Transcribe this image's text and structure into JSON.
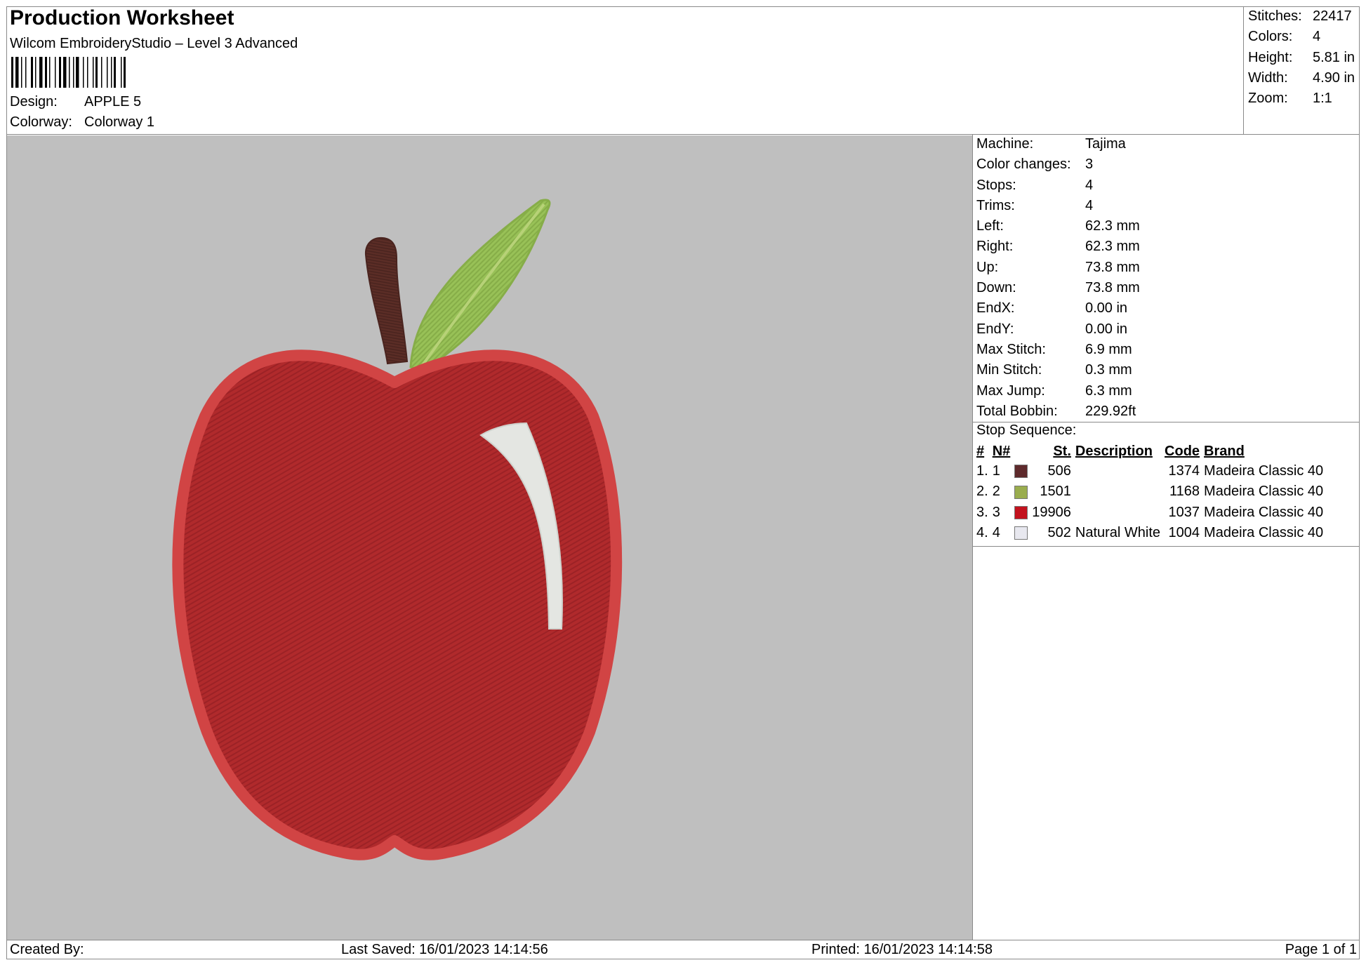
{
  "header": {
    "title": "Production Worksheet",
    "software": "Wilcom EmbroideryStudio – Level 3 Advanced",
    "design_label": "Design:",
    "design_value": "APPLE 5",
    "colorway_label": "Colorway:",
    "colorway_value": "Colorway 1"
  },
  "summary": [
    {
      "label": "Stitches:",
      "value": "22417"
    },
    {
      "label": "Colors:",
      "value": "4"
    },
    {
      "label": "Height:",
      "value": "5.81 in"
    },
    {
      "label": "Width:",
      "value": "4.90 in"
    },
    {
      "label": "Zoom:",
      "value": "1:1"
    }
  ],
  "specs": [
    {
      "label": "Machine:",
      "value": "Tajima"
    },
    {
      "label": "Color changes:",
      "value": "3"
    },
    {
      "label": "Stops:",
      "value": "4"
    },
    {
      "label": "Trims:",
      "value": "4"
    },
    {
      "label": "Left:",
      "value": "62.3 mm"
    },
    {
      "label": "Right:",
      "value": "62.3 mm"
    },
    {
      "label": "Up:",
      "value": "73.8 mm"
    },
    {
      "label": "Down:",
      "value": "73.8 mm"
    },
    {
      "label": "EndX:",
      "value": "0.00 in"
    },
    {
      "label": "EndY:",
      "value": "0.00 in"
    },
    {
      "label": "Max Stitch:",
      "value": "6.9 mm"
    },
    {
      "label": "Min Stitch:",
      "value": "0.3 mm"
    },
    {
      "label": "Max Jump:",
      "value": "6.3 mm"
    },
    {
      "label": "Total Bobbin:",
      "value": "229.92ft"
    }
  ],
  "stop_sequence": {
    "label": "Stop Sequence:",
    "columns": {
      "index": "#",
      "needle": "N#",
      "stitches": "St.",
      "description": "Description",
      "code": "Code",
      "brand": "Brand"
    },
    "rows": [
      {
        "index": "1.",
        "needle": "1",
        "color": "#5e2a2c",
        "stitches": "506",
        "description": "",
        "code": "1374",
        "brand": "Madeira Classic 40"
      },
      {
        "index": "2.",
        "needle": "2",
        "color": "#9aad4e",
        "stitches": "1501",
        "description": "",
        "code": "1168",
        "brand": "Madeira Classic 40"
      },
      {
        "index": "3.",
        "needle": "3",
        "color": "#c3121e",
        "stitches": "19906",
        "description": "",
        "code": "1037",
        "brand": "Madeira Classic 40"
      },
      {
        "index": "4.",
        "needle": "4",
        "color": "#e8e8ef",
        "stitches": "502",
        "description": "Natural White",
        "code": "1004",
        "brand": "Madeira Classic 40"
      }
    ]
  },
  "footer": {
    "created": "Created By:",
    "last_saved": "Last Saved: 16/01/2023 14:14:56",
    "printed": "Printed: 16/01/2023 14:14:58",
    "page": "Page 1 of 1"
  },
  "preview": {
    "background_color": "#bfbfbf",
    "apple_color": "#b02a2c",
    "apple_border_color": "#cc3a3a",
    "stem_color": "#5b2d26",
    "leaf_color": "#98c157",
    "highlight_color": "#e4e6e2"
  }
}
